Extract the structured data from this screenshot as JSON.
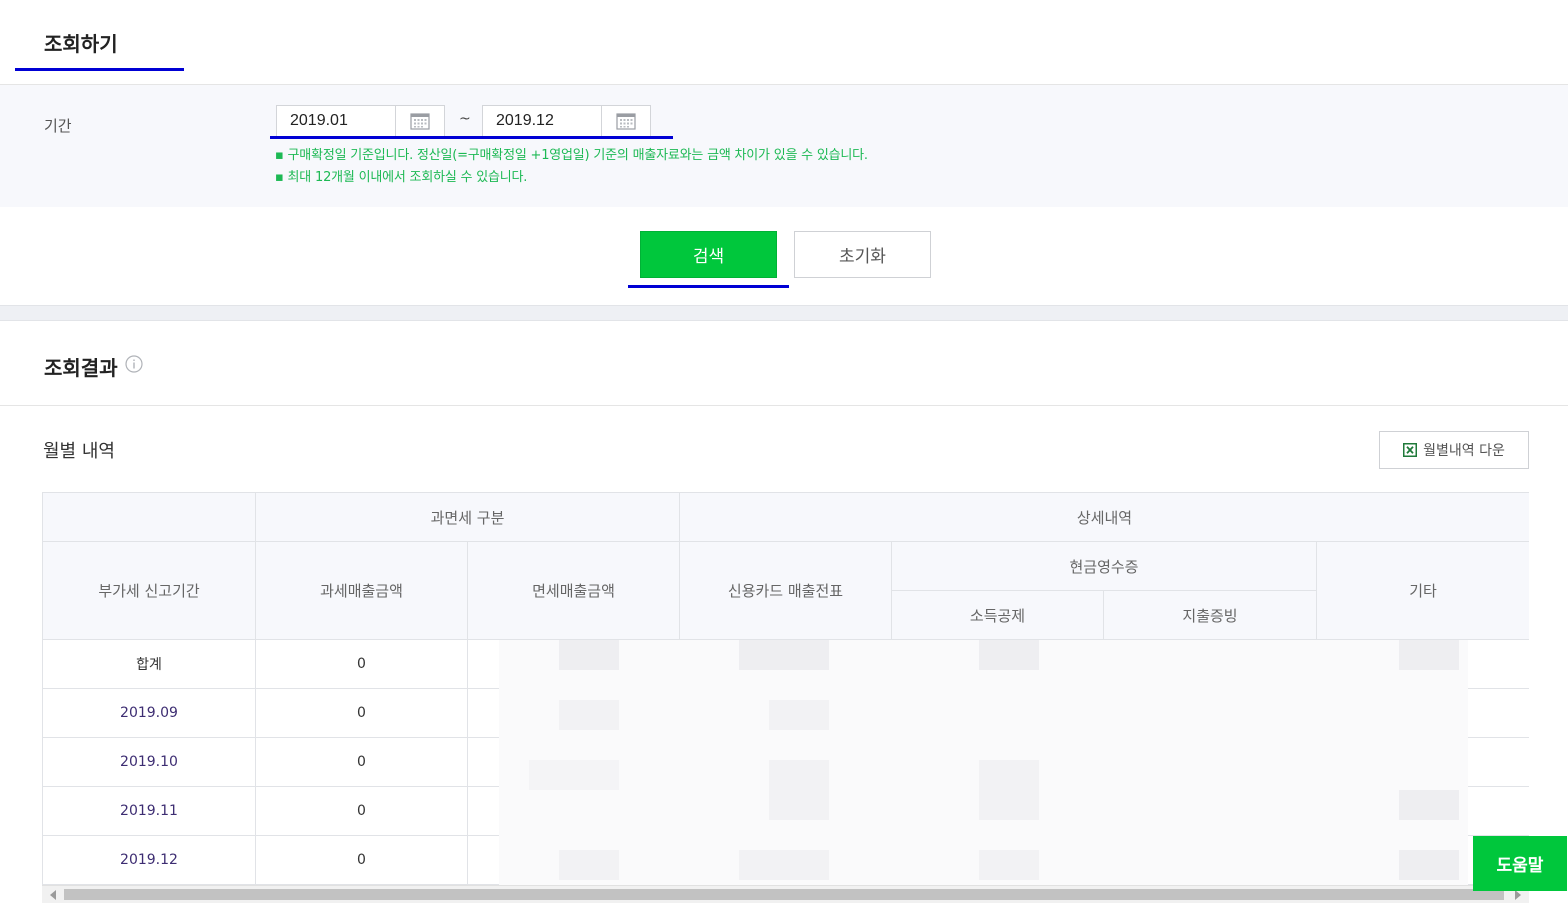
{
  "query_section": {
    "title": "조회하기",
    "period_label": "기간",
    "start_date": "2019.01",
    "end_date": "2019.12",
    "range_separator": "~",
    "notices": [
      "▪ 구매확정일 기준입니다. 정산일(=구매확정일 +1영업일) 기준의 매출자료와는 금액 차이가 있을 수 있습니다.",
      "▪ 최대 12개월 이내에서 조회하실 수 있습니다."
    ],
    "search_label": "검색",
    "reset_label": "초기화"
  },
  "result_section": {
    "title": "조회결과",
    "subtitle": "월별 내역",
    "download_label": "월별내역 다운"
  },
  "table": {
    "headers": {
      "period": "부가세 신고기간",
      "tax_group": "과면세 구분",
      "taxable": "과세매출금액",
      "exempt": "면세매출금액",
      "detail_group": "상세내역",
      "credit_card": "신용카드 매출전표",
      "cash_receipt": "현금영수증",
      "income_deduction": "소득공제",
      "expense_proof": "지출증빙",
      "other": "기타"
    },
    "rows": [
      {
        "period": "합계",
        "taxable": "0"
      },
      {
        "period": "2019.09",
        "taxable": "0"
      },
      {
        "period": "2019.10",
        "taxable": "0"
      },
      {
        "period": "2019.11",
        "taxable": "0"
      },
      {
        "period": "2019.12",
        "taxable": "0"
      }
    ]
  },
  "help_label": "도움말",
  "colors": {
    "primary_green": "#00c73c",
    "notice_green": "#1db954",
    "annotation_blue": "#0000d4",
    "period_text": "#3d2d72"
  }
}
